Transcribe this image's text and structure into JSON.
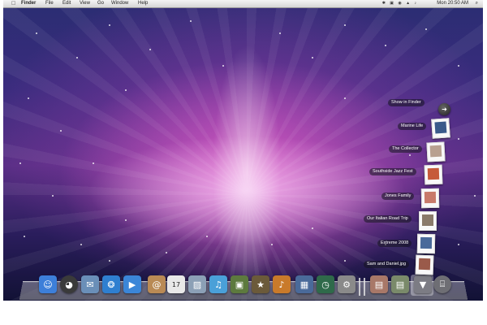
{
  "menubar": {
    "apple": "",
    "menus": [
      "Finder",
      "File",
      "Edit",
      "View",
      "Go",
      "Window",
      "Help"
    ],
    "status_icons": "✱ ▣ ◉ ▲ ♪",
    "clock": "Mon 20:50 AM",
    "spotlight": "⌕"
  },
  "stack": {
    "show_in_finder": "Show in Finder",
    "items": [
      {
        "label": "Marine Life"
      },
      {
        "label": "The Collector"
      },
      {
        "label": "Southside Jazz Fest"
      },
      {
        "label": "Jones Family"
      },
      {
        "label": "Our Italian Road Trip"
      },
      {
        "label": "Extreme 2008"
      },
      {
        "label": "Sam and Daniel.jpg"
      }
    ]
  },
  "dock": {
    "apps": [
      {
        "name": "finder-icon",
        "glyph": "☺",
        "color": "#3d7fd9"
      },
      {
        "name": "dashboard-icon",
        "glyph": "◕",
        "color": "#3a3a3a"
      },
      {
        "name": "mail-icon",
        "glyph": "✉",
        "color": "#6a8fb8"
      },
      {
        "name": "safari-icon",
        "glyph": "❂",
        "color": "#2f7fd0"
      },
      {
        "name": "ichat-icon",
        "glyph": "▶",
        "color": "#3b86d8"
      },
      {
        "name": "address-book-icon",
        "glyph": "@",
        "color": "#b98a55"
      },
      {
        "name": "ical-icon",
        "glyph": "17",
        "color": "#e8e8e8"
      },
      {
        "name": "preview-icon",
        "glyph": "▨",
        "color": "#8ca0b6"
      },
      {
        "name": "itunes-icon",
        "glyph": "♫",
        "color": "#4aa0d8"
      },
      {
        "name": "iphoto-icon",
        "glyph": "▣",
        "color": "#5d7a3e"
      },
      {
        "name": "imovie-icon",
        "glyph": "★",
        "color": "#6b5a3a"
      },
      {
        "name": "garageband-icon",
        "glyph": "♪",
        "color": "#c97a2a"
      },
      {
        "name": "spaces-icon",
        "glyph": "▦",
        "color": "#4a6a9a"
      },
      {
        "name": "time-machine-icon",
        "glyph": "◷",
        "color": "#2f6a4a"
      },
      {
        "name": "system-preferences-icon",
        "glyph": "⚙",
        "color": "#8a8a8a"
      },
      {
        "name": "pictures-stack-icon",
        "glyph": "▤",
        "color": "#a87868"
      },
      {
        "name": "documents-stack-icon",
        "glyph": "▤",
        "color": "#7a8a6a"
      },
      {
        "name": "downloads-stack-icon",
        "glyph": "▼",
        "color": "#7c7c84"
      },
      {
        "name": "trash-icon",
        "glyph": "⌸",
        "color": "#6e6e74"
      }
    ]
  }
}
